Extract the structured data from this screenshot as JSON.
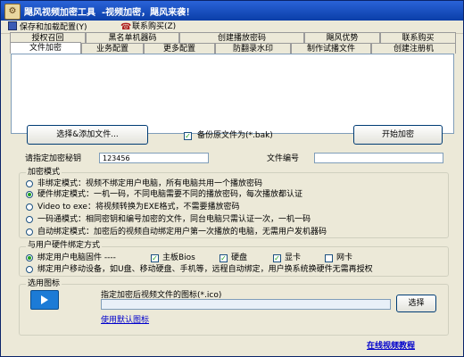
{
  "window": {
    "title": "飓风视频加密工具  -视频加密，飓风来袭！"
  },
  "menu": {
    "items": [
      {
        "label": "保存和加载配置(Y)"
      },
      {
        "label": "联系购买(Z)"
      }
    ]
  },
  "tabs": {
    "row1": [
      "授权召回",
      "黑名单机器码",
      "创建播放密码",
      "飓风优势",
      "联系购买"
    ],
    "row2": [
      "文件加密",
      "业务配置",
      "更多配置",
      "防翻录水印",
      "制作试播文件",
      "创建注册机"
    ],
    "active": "文件加密"
  },
  "file_actions": {
    "select_button": "选择&添加文件...",
    "backup_checkbox": "备份原文件为(*.bak)",
    "backup_checked": true,
    "start_button": "开始加密"
  },
  "password": {
    "label": "请指定加密秘钥",
    "value": "123456"
  },
  "file_number": {
    "label": "文件编号",
    "value": ""
  },
  "encrypt_mode": {
    "title": "加密模式",
    "options": [
      {
        "label": "非绑定模式：视频不绑定用户电脑，所有电脑共用一个播放密码",
        "selected": false
      },
      {
        "label": "硬件绑定模式：一机一码，不同电脑需要不同的播放密码，每次播放都认证",
        "selected": true
      },
      {
        "label": "Video to exe：将视频转换为EXE格式，不需要播放密码",
        "selected": false
      },
      {
        "label": "一码通模式：相同密钥和编号加密的文件，同台电脑只需认证一次，一机一码",
        "selected": false
      },
      {
        "label": "自动绑定模式：加密后的视频自动绑定用户第一次播放的电脑，无需用户发机器码",
        "selected": false
      }
    ]
  },
  "hardware_bind": {
    "title": "与用户硬件绑定方式",
    "row1_label": "绑定用户电脑固件 ----",
    "row1_selected": true,
    "checks": [
      {
        "label": "主板Bios",
        "checked": true
      },
      {
        "label": "硬盘",
        "checked": true
      },
      {
        "label": "显卡",
        "checked": true
      },
      {
        "label": "网卡",
        "checked": false
      }
    ],
    "row2_label": "绑定用户移动设备，如U盘、移动硬盘、手机等，远程自动绑定，用户换系统换硬件无需再授权",
    "row2_selected": false
  },
  "icon_section": {
    "title": "选用图标",
    "caption": "指定加密后视频文件的图标(*.ico)",
    "path": "",
    "choose_button": "选择",
    "default_link": "使用默认图标"
  },
  "footer": {
    "tutorial_link": "在线视频教程"
  },
  "colors": {
    "title_bar": "#0a3ea8",
    "panel_bg": "#ece9d8",
    "link": "#0000cc",
    "check": "#21a121"
  }
}
